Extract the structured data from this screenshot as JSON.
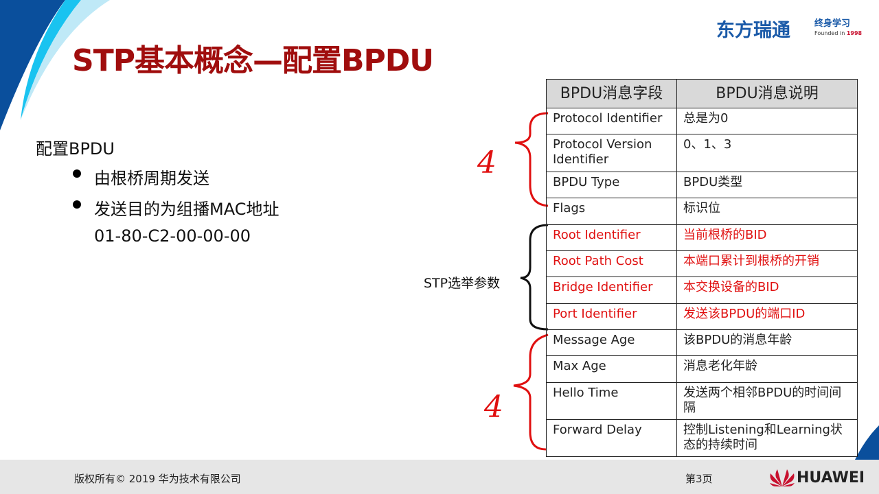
{
  "title": "STP基本概念—配置BPDU",
  "logo": {
    "brand": "东方瑞通",
    "sub": "终身学习",
    "founded_prefix": "Founded in ",
    "founded_year": "1998"
  },
  "content": {
    "heading": "配置BPDU",
    "bullets": [
      "由根桥周期发送",
      "发送目的为组播MAC地址"
    ],
    "mac": "01-80-C2-00-00-00"
  },
  "annotations": {
    "stp_label": "STP选举参数",
    "hand_top": "4",
    "hand_bottom": "4"
  },
  "table": {
    "headers": [
      "BPDU消息字段",
      "BPDU消息说明"
    ],
    "rows": [
      {
        "field": "Protocol Identifier",
        "desc": "总是为0",
        "highlight": false
      },
      {
        "field": "Protocol Version Identifier",
        "desc": "0、1、3",
        "highlight": false
      },
      {
        "field": "BPDU Type",
        "desc": "BPDU类型",
        "highlight": false
      },
      {
        "field": "Flags",
        "desc": "标识位",
        "highlight": false
      },
      {
        "field": "Root Identifier",
        "desc": "当前根桥的BID",
        "highlight": true
      },
      {
        "field": "Root Path Cost",
        "desc": "本端口累计到根桥的开销",
        "highlight": true
      },
      {
        "field": "Bridge Identifier",
        "desc": "本交换设备的BID",
        "highlight": true
      },
      {
        "field": "Port Identifier",
        "desc": "发送该BPDU的端口ID",
        "highlight": true
      },
      {
        "field": "Message Age",
        "desc": "该BPDU的消息年龄",
        "highlight": false
      },
      {
        "field": "Max Age",
        "desc": "消息老化年龄",
        "highlight": false
      },
      {
        "field": "Hello Time",
        "desc": "发送两个相邻BPDU的时间间隔",
        "highlight": false
      },
      {
        "field": "Forward Delay",
        "desc": "控制Listening和Learning状态的持续时间",
        "highlight": false
      }
    ]
  },
  "footer": {
    "copyright": "版权所有© 2019 华为技术有限公司",
    "page": "第3页",
    "brand": "HUAWEI"
  },
  "colors": {
    "title": "#a00d0d",
    "highlight": "#e01010",
    "header_bg": "#d9d9d9",
    "footer_bg": "#e6e6e6",
    "blue_dark": "#0a4f9c",
    "blue_light": "#19c3f0"
  }
}
